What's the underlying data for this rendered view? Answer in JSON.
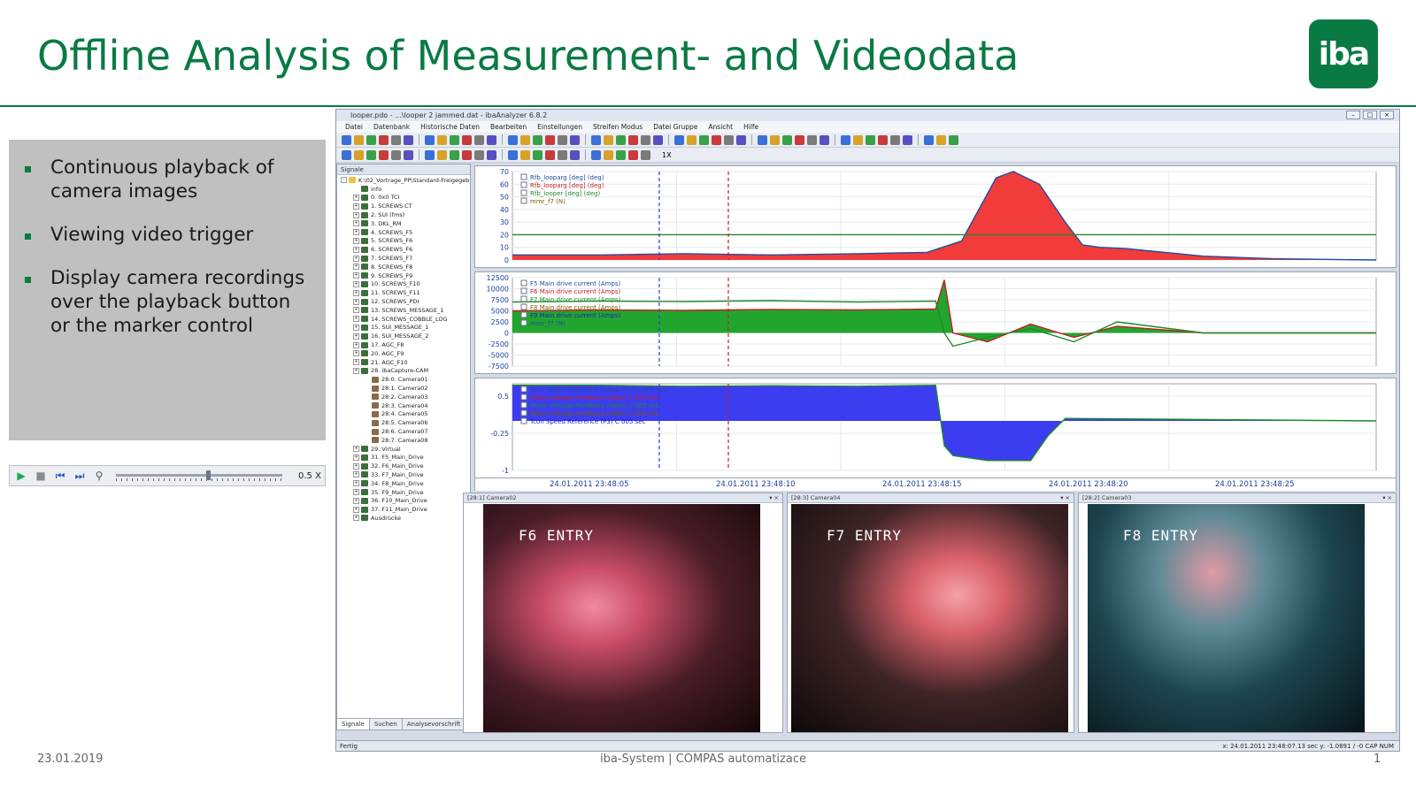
{
  "slide": {
    "title": "Offline Analysis of Measurement- and Videodata",
    "logo_text": "iba",
    "bullets": [
      "Continuous playback of camera images",
      "Viewing video trigger",
      "Display camera recordings over the playback button or the marker control"
    ],
    "playbar_speed": "0.5 X",
    "footer": {
      "date": "23.01.2019",
      "center": "iba-System | COMPAS automatizace",
      "page": "1"
    }
  },
  "app": {
    "title": "looper.pdo - ...\\looper 2 jammed.dat - ibaAnalyzer 6.8.2",
    "menu": [
      "Datei",
      "Datenbank",
      "Historische Daten",
      "Bearbeiten",
      "Einstellungen",
      "Streifen Modus",
      "Datei Gruppe",
      "Ansicht",
      "Hilfe"
    ],
    "toolbar_speed": "1X",
    "signal_panel": {
      "header": "Signale",
      "root": "K:\\02_Vortrage_PP\\Standard-Freigegeb",
      "items": [
        "info",
        "0. 0x0 TCI",
        "1. SCREWS CT",
        "2. SUI (fms)",
        "3. DKL_RM",
        "4. SCREWS_F5",
        "5. SCREWS_F6",
        "6. SCREWS_F6",
        "7. SCREWS_F7",
        "8. SCREWS_F8",
        "9. SCREWS_F9",
        "10. SCREWS_F10",
        "11. SCREWS_F11",
        "12. SCREWS_PDI",
        "13. SCREWS_MESSAGE_1",
        "14. SCREWS_COBBLE_LOG",
        "15. SUI_MESSAGE_1",
        "16. SUI_MESSAGE_2",
        "17. AGC_F8",
        "20. AGC_F9",
        "21. AGC_F10",
        "28. ibaCapture-CAM",
        "28:0. Camera01",
        "28:1. Camera02",
        "28:2. Camera03",
        "28:3. Camera04",
        "28:4. Camera05",
        "28:5. Camera06",
        "28:6. Camera07",
        "28:7. Camera08",
        "29. Virtual",
        "31. F5_Main_Drive",
        "32. F6_Main_Drive",
        "33. F7_Main_Drive",
        "34. F8_Main_Drive",
        "35. F9_Main_Drive",
        "36. F10_Main_Drive",
        "37. F11_Main_Drive",
        "Ausdrücke"
      ],
      "tabs": [
        "Signale",
        "Suchen",
        "Analysevorschrift"
      ]
    },
    "cameras": [
      {
        "header": "[28:1] Camera02",
        "label": "F6 ENTRY"
      },
      {
        "header": "[28:3] Camera04",
        "label": "F7 ENTRY"
      },
      {
        "header": "[28:2] Camera03",
        "label": "F8 ENTRY"
      }
    ],
    "status_left": "Fertig",
    "status_right": "x: 24.01.2011 23:48:07.13 sec   y: -1.0891 / -0  CAP  NUM",
    "colors": {
      "green": "#0a7a45",
      "red_fill": "#f23b3b",
      "green_fill": "#22a52e",
      "blue_fill": "#3c3cf0",
      "marker_blue": "#2a3fc9",
      "marker_red": "#d11a1a"
    }
  },
  "chart_data": [
    {
      "type": "area",
      "legend": [
        "Rfb_looparg [deg] (deg)",
        "Rfb_looparg [deg] (deg)",
        "Rfb_looper [deg] (deg)",
        "mmr_f7 (N)"
      ],
      "ylim": [
        0,
        70
      ],
      "yticks": [
        0,
        10,
        20,
        30,
        40,
        50,
        60,
        70
      ],
      "x": [
        0,
        10,
        20,
        30,
        40,
        48,
        52,
        56,
        58,
        61,
        64,
        66,
        68,
        71,
        74,
        80,
        88,
        100
      ],
      "series": [
        {
          "name": "Rfb_looparg [deg] (deg)",
          "values": [
            4,
            4,
            5,
            4,
            5,
            6,
            15,
            65,
            70,
            60,
            30,
            12,
            10,
            9,
            7,
            3,
            1,
            0
          ]
        },
        {
          "name": "mmr_f7 (N)",
          "values": [
            20,
            20,
            20,
            20,
            20,
            20,
            20,
            20,
            20,
            20,
            20,
            20,
            20,
            20,
            20,
            20,
            20,
            20
          ]
        }
      ]
    },
    {
      "type": "area",
      "legend": [
        "F5 Main drive current (Amps)",
        "F6 Main drive current (Amps)",
        "F7 Main drive current (Amps)",
        "F8 Main drive current (Amps)",
        "F9 Main drive current (Amps)",
        "mmr_f7 (N)"
      ],
      "ylim": [
        -7500,
        12500
      ],
      "yticks": [
        -7500,
        -5000,
        -2500,
        0,
        2500,
        5000,
        7500,
        10000,
        12500
      ],
      "x": [
        0,
        10,
        20,
        30,
        40,
        49,
        50,
        51,
        55,
        60,
        65,
        70,
        80,
        100
      ],
      "series": [
        {
          "name": "F6 Main drive current (Amps)",
          "values": [
            5000,
            5200,
            5100,
            5300,
            5200,
            5400,
            12000,
            0,
            -2000,
            2000,
            -1000,
            1500,
            0,
            0
          ]
        },
        {
          "name": "F5 Main drive current (Amps)",
          "values": [
            7000,
            7200,
            7100,
            7300,
            7000,
            7200,
            0,
            -3000,
            -1000,
            1000,
            -2000,
            2500,
            0,
            0
          ]
        }
      ]
    },
    {
      "type": "area",
      "legend": [
        "Tcon Speed Reference Actual (P5) C 005 sec",
        "Motor Voltage Feedback (Volts) C 005 sec",
        "Motor Voltage Feedback (Volts) C 005 sec",
        "Motor Voltage Feedback (Volts) C 005 sec",
        "Tcon Speed Reference (P3) C 005 sec"
      ],
      "ylim": [
        -1.0,
        0.75
      ],
      "yticks": [
        -1.0,
        -0.25,
        0.5
      ],
      "xticks": [
        "24.01.2011 23:48:05",
        "24.01.2011 23:48:10",
        "24.01.2011 23:48:15",
        "24.01.2011 23:48:20",
        "24.01.2011 23:48:25"
      ],
      "x": [
        0,
        10,
        20,
        30,
        40,
        49,
        50,
        51,
        55,
        60,
        62,
        64,
        100
      ],
      "series": [
        {
          "name": "Tcon Speed Reference Actual (P5) C 005 sec",
          "values": [
            0.72,
            0.72,
            0.7,
            0.71,
            0.7,
            0.72,
            -0.5,
            -0.7,
            -0.8,
            -0.8,
            -0.3,
            0.05,
            0.0
          ]
        }
      ]
    }
  ]
}
